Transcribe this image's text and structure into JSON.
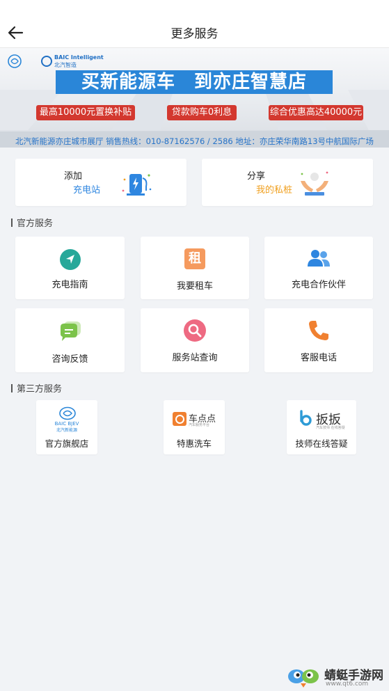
{
  "header": {
    "title": "更多服务"
  },
  "banner": {
    "brand_en": "BAIC Intelligent",
    "brand_cn": "北汽智造",
    "headline": "买新能源车　到亦庄智慧店",
    "pill1": "最高10000元置换补贴",
    "pill2": "贷款购车0利息",
    "pill3": "综合优惠高达40000元",
    "footer": "北汽新能源亦庄城市展厅  销售热线：010-87162576 / 2586   地址：亦庄荣华南路13号中航国际广场"
  },
  "quick": {
    "add": {
      "line1": "添加",
      "line2": "充电站"
    },
    "share": {
      "line1": "分享",
      "line2": "我的私桩"
    }
  },
  "official": {
    "title": "官方服务",
    "items": [
      "充电指南",
      "我要租车",
      "充电合作伙伴",
      "咨询反馈",
      "服务站查询",
      "客服电话"
    ],
    "rent_glyph": "租"
  },
  "third_party": {
    "title": "第三方服务",
    "items": [
      {
        "label": "官方旗舰店",
        "logo_text": "BAIC BJEV",
        "logo_sub": "北汽新能源"
      },
      {
        "label": "特惠洗车",
        "logo_text": "车点点",
        "logo_sub": "汽车服务平台"
      },
      {
        "label": "技师在线答疑",
        "logo_text": "扳扳",
        "logo_sub": "汽车技师 在线答疑"
      }
    ]
  },
  "watermark": {
    "text": "蜻蜓手游网",
    "url": "www.qt6.com"
  },
  "colors": {
    "blue": "#2a86d8",
    "red": "#d3382f",
    "add_text": "#2e86e0",
    "share_text": "#f0a020",
    "teal": "#27a89a",
    "orange": "#f08030",
    "green": "#7cc34a",
    "pink": "#ee6a82"
  }
}
